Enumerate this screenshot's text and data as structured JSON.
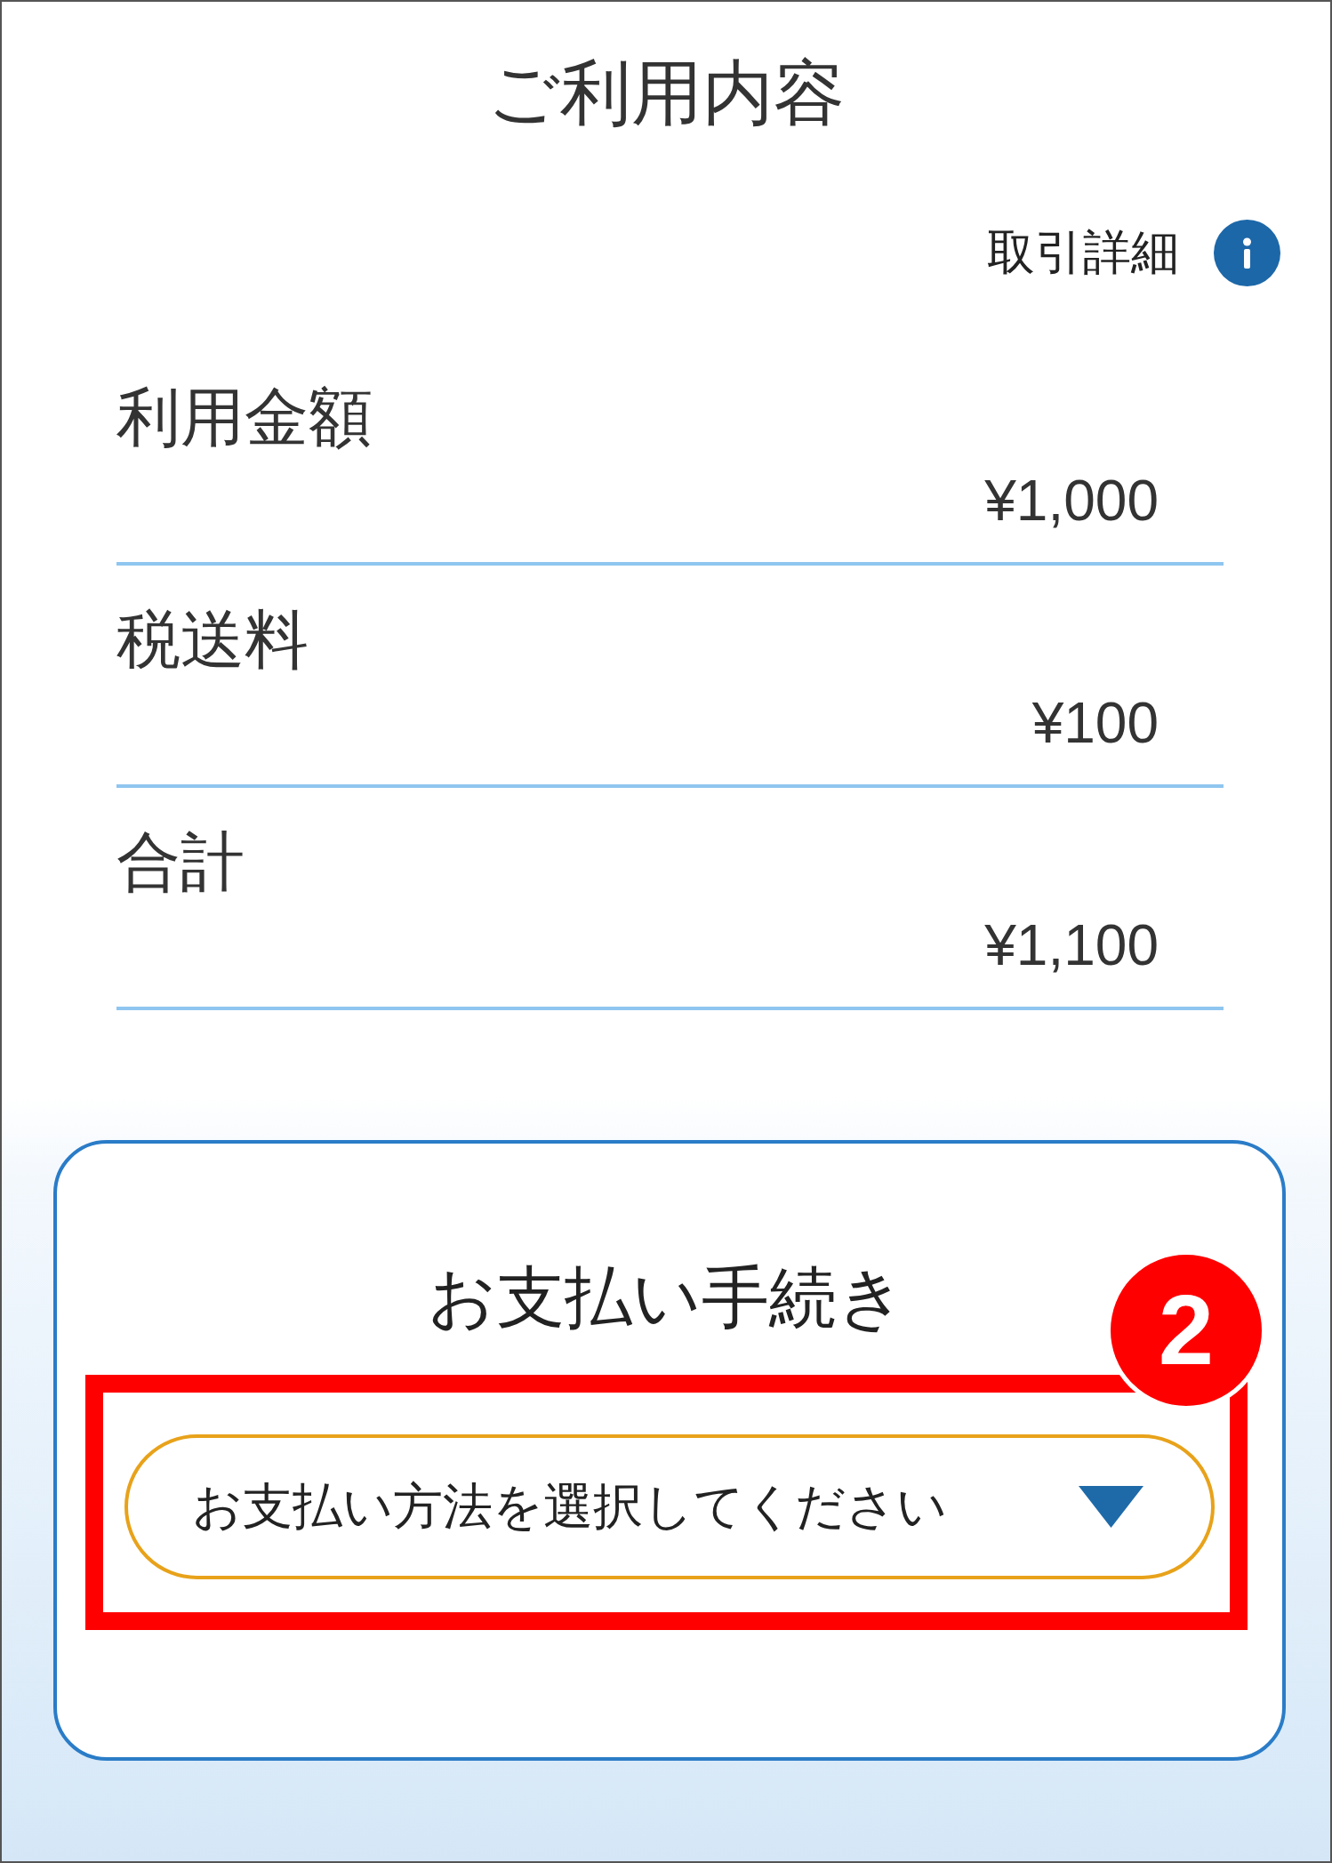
{
  "header": {
    "title": "ご利用内容",
    "details_link": {
      "label": "取引詳細"
    }
  },
  "amounts": [
    {
      "label": "利用金額",
      "value": "¥1,000"
    },
    {
      "label": "税送料",
      "value": "¥100"
    },
    {
      "label": "合計",
      "value": "¥1,100"
    }
  ],
  "payment_card": {
    "title": "お支払い手続き",
    "method_select": {
      "placeholder": "お支払い方法を選択してください"
    }
  },
  "annotation": {
    "step": "2"
  }
}
